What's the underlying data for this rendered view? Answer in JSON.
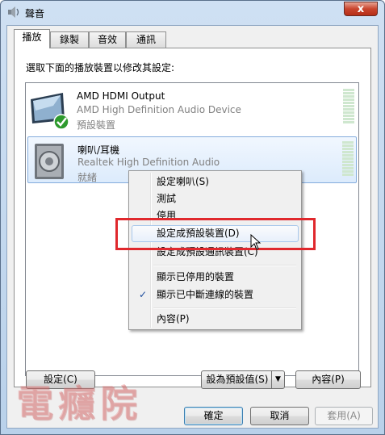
{
  "window": {
    "title": "聲音",
    "close_label": "x"
  },
  "tabs": [
    {
      "label": "播放",
      "active": true
    },
    {
      "label": "錄製",
      "active": false
    },
    {
      "label": "音效",
      "active": false
    },
    {
      "label": "通訊",
      "active": false
    }
  ],
  "instruction": "選取下面的播放裝置以修改其設定:",
  "devices": [
    {
      "name": "AMD HDMI Output",
      "description": "AMD High Definition Audio Device",
      "status": "預設裝置"
    },
    {
      "name": "喇叭/耳機",
      "description": "Realtek High Definition Audio",
      "status": "就緒"
    }
  ],
  "context_menu": {
    "items": [
      {
        "label": "設定喇叭(S)"
      },
      {
        "label": "測試"
      },
      {
        "label": "停用"
      },
      {
        "label": "設定成預設裝置(D)"
      },
      {
        "label": "設定成預設通訊裝置(C)"
      },
      {
        "label": "顯示已停用的裝置"
      },
      {
        "label": "顯示已中斷連線的裝置",
        "checked": true
      },
      {
        "label": "內容(P)"
      }
    ]
  },
  "buttons": {
    "configure": "設定(C)",
    "set_default": "設為預設值(S)",
    "properties": "內容(P)",
    "ok": "確定",
    "cancel": "取消",
    "apply": "套用(A)"
  },
  "watermark": "電癮院",
  "colors": {
    "highlight_box": "#e0282d",
    "accent": "#3c7fb1"
  }
}
